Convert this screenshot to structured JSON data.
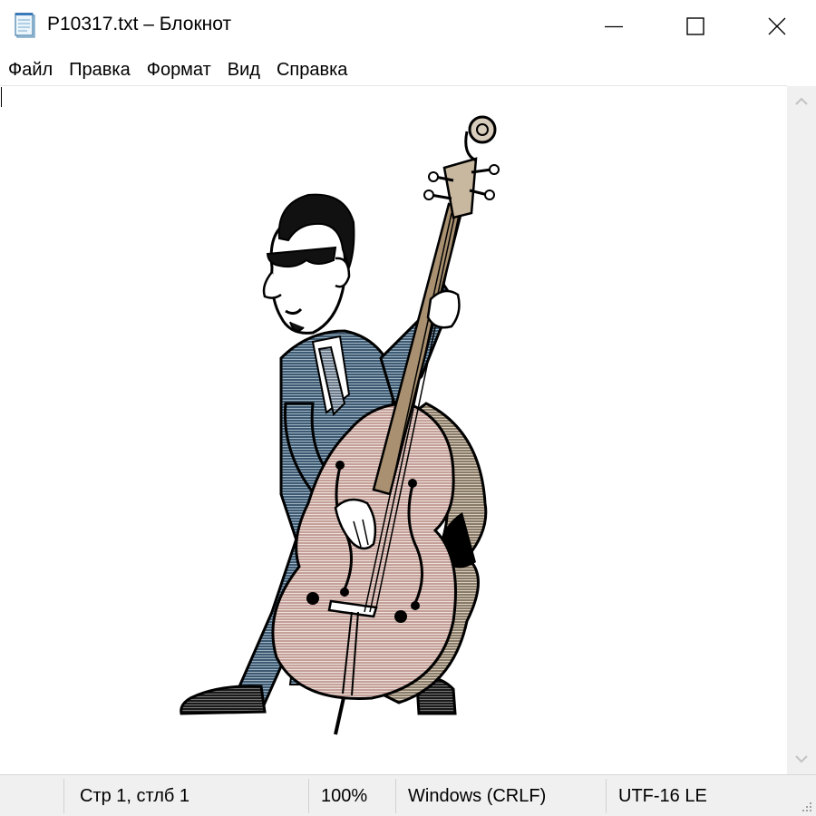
{
  "window": {
    "title": "P10317.txt – Блокнот"
  },
  "menu": {
    "items": [
      "Файл",
      "Правка",
      "Формат",
      "Вид",
      "Справка"
    ]
  },
  "icons": {
    "app": "notepad-icon",
    "minimize": "minimize-icon",
    "maximize": "maximize-icon",
    "close": "close-icon",
    "scroll_up": "chevron-up-icon",
    "scroll_down": "chevron-down-icon",
    "grip": "resize-grip-icon"
  },
  "status": {
    "position": "Стр 1, стлб 1",
    "zoom": "100%",
    "line_endings": "Windows (CRLF)",
    "encoding": "UTF-16 LE"
  },
  "colors": {
    "suit": "#3d5a72",
    "bass_body": "#b89088",
    "bass_side": "#8a7a68",
    "outline": "#000000"
  }
}
